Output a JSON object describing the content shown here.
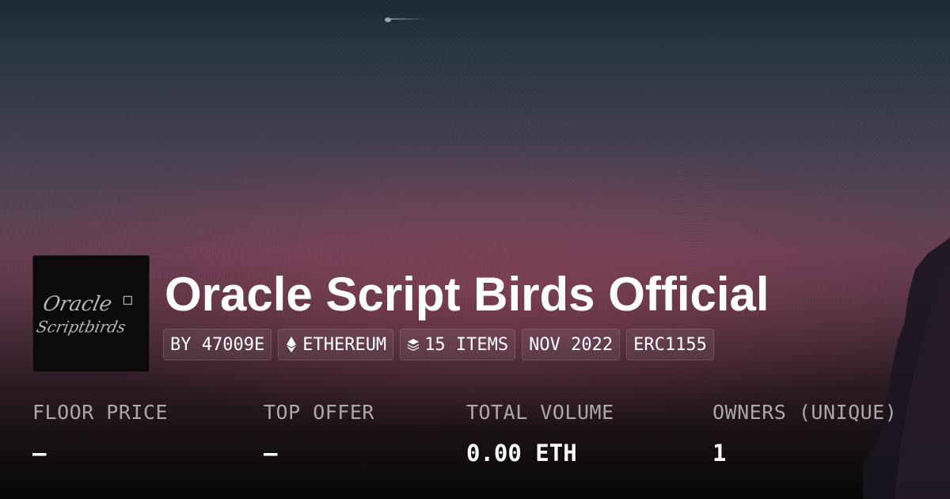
{
  "collection": {
    "title": "Oracle Script Birds Official",
    "logo_text_line1": "Oracle",
    "logo_text_line2": "Scriptbirds"
  },
  "chips": [
    {
      "label": "BY 47009E",
      "icon": ""
    },
    {
      "label": "ETHEREUM",
      "icon": "ethereum-icon"
    },
    {
      "label": "15 ITEMS",
      "icon": "layers-icon"
    },
    {
      "label": "NOV 2022",
      "icon": ""
    },
    {
      "label": "ERC1155",
      "icon": ""
    }
  ],
  "stats": [
    {
      "label": "FLOOR PRICE",
      "value": "–"
    },
    {
      "label": "TOP OFFER",
      "value": "–"
    },
    {
      "label": "TOTAL VOLUME",
      "value": "0.00 ETH"
    },
    {
      "label": "OWNERS (UNIQUE)",
      "value": "1"
    }
  ],
  "colors": {
    "text": "#ffffff",
    "label": "#bdb4b8",
    "sky_top": "#1c2a36",
    "sky_mid": "#673e52",
    "bottom": "#070607"
  }
}
